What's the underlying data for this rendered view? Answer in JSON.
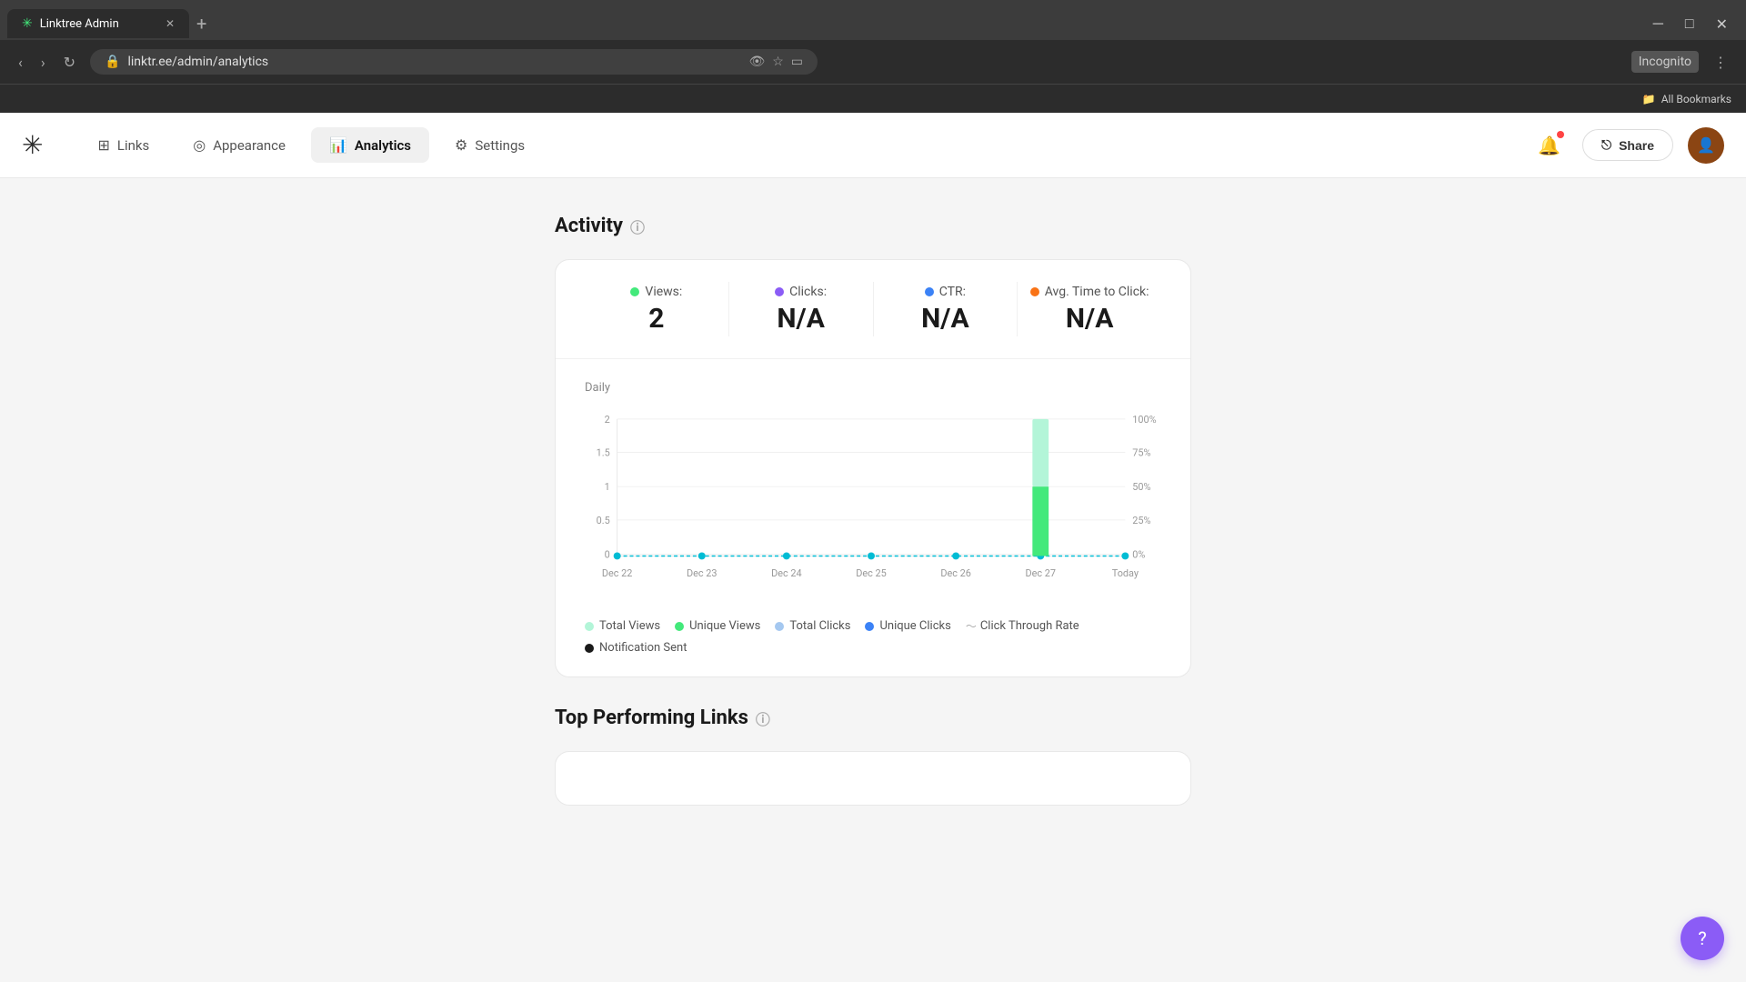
{
  "browser": {
    "tab_title": "Linktree Admin",
    "tab_favicon": "✳",
    "url": "linktr.ee/admin/analytics",
    "new_tab_icon": "+",
    "bookmarks_label": "All Bookmarks",
    "incognito_label": "Incognito"
  },
  "nav": {
    "logo": "✳",
    "links_label": "Links",
    "appearance_label": "Appearance",
    "analytics_label": "Analytics",
    "settings_label": "Settings",
    "share_label": "Share"
  },
  "activity": {
    "section_title": "Activity",
    "daily_label": "Daily",
    "metrics": {
      "views_label": "Views:",
      "views_value": "2",
      "clicks_label": "Clicks:",
      "clicks_value": "N/A",
      "ctr_label": "CTR:",
      "ctr_value": "N/A",
      "avg_time_label": "Avg. Time to Click:",
      "avg_time_value": "N/A"
    },
    "chart": {
      "y_left": [
        "2",
        "1.5",
        "1",
        "0.5",
        "0"
      ],
      "y_right": [
        "100%",
        "75%",
        "50%",
        "25%",
        "0%"
      ],
      "x_labels": [
        "Dec 22",
        "Dec 23",
        "Dec 24",
        "Dec 25",
        "Dec 26",
        "Dec 27",
        "Today"
      ]
    },
    "legend": {
      "total_views": "Total Views",
      "unique_views": "Unique Views",
      "total_clicks": "Total Clicks",
      "unique_clicks": "Unique Clicks",
      "ctr": "Click Through Rate",
      "notification_sent": "Notification Sent"
    }
  },
  "top_links": {
    "section_title": "Top Performing Links"
  }
}
